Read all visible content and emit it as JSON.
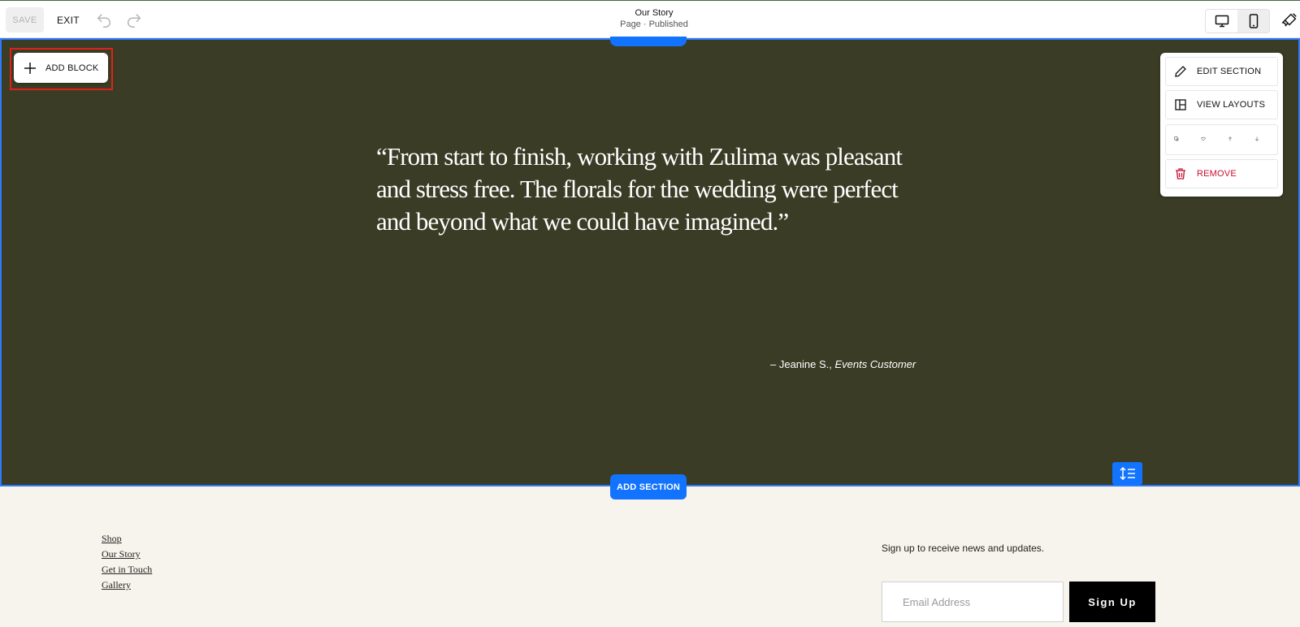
{
  "toolbar": {
    "save_label": "SAVE",
    "exit_label": "EXIT",
    "page_title": "Our Story",
    "page_status": "Page · Published"
  },
  "section": {
    "add_block_label": "ADD BLOCK",
    "quote": "“From start to finish, working with Zulima was pleasant and stress free. The florals for the wedding were perfect and beyond what we could have imagined.”",
    "attribution_name": "– Jeanine S.,",
    "attribution_role": "Events Customer",
    "background_color": "#3a3c25",
    "accent_color": "#1273ff"
  },
  "section_menu": {
    "edit_label": "EDIT SECTION",
    "layouts_label": "VIEW LAYOUTS",
    "remove_label": "REMOVE"
  },
  "add_section_label": "ADD SECTION",
  "footer": {
    "links": [
      "Shop",
      "Our Story",
      "Get in Touch",
      "Gallery"
    ],
    "newsletter_text": "Sign up to receive news and updates.",
    "email_placeholder": "Email Address",
    "signup_label": "Sign Up"
  }
}
